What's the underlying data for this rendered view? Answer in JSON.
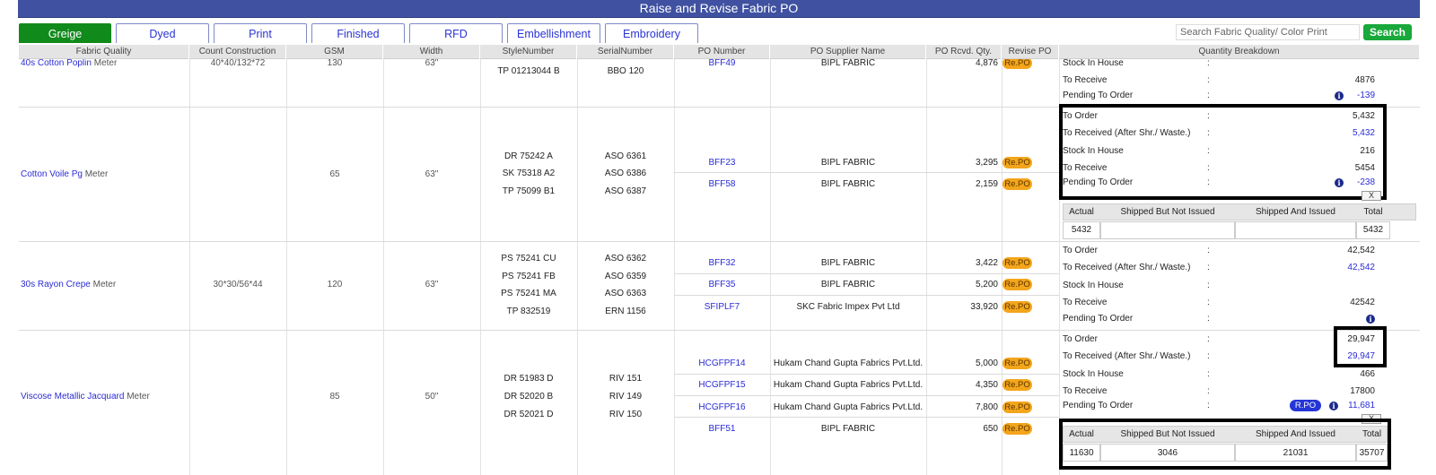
{
  "title": "Raise and Revise Fabric PO",
  "tabs": [
    {
      "label": "Greige",
      "active": true
    },
    {
      "label": "Dyed",
      "active": false
    },
    {
      "label": "Print",
      "active": false
    },
    {
      "label": "Finished",
      "active": false
    },
    {
      "label": "RFD",
      "active": false
    },
    {
      "label": "Embellishment",
      "active": false
    },
    {
      "label": "Embroidery",
      "active": false
    }
  ],
  "search": {
    "placeholder": "Search Fabric Quality/ Color Print",
    "button_label": "Search"
  },
  "columns": [
    "Fabric Quality",
    "Count Construction",
    "GSM",
    "Width",
    "StyleNumber",
    "SerialNumber",
    "PO Number",
    "PO Supplier Name",
    "PO Rcvd. Qty.",
    "Revise PO",
    "Quantity Breakdown"
  ],
  "labels": {
    "to_order": "To Order",
    "to_received": "To Received (After Shr./ Waste.)",
    "stock_in_house": "Stock In House",
    "to_receive": "To Receive",
    "pending_to_order": "Pending To Order",
    "colon": ":",
    "revise_badge": "Re.PO",
    "rpo_badge": "R.PO",
    "close": "X",
    "info": "i"
  },
  "breakdown_headers": [
    "Actual",
    "Shipped But Not Issued",
    "Shipped And Issued",
    "Total"
  ],
  "rows": [
    {
      "fabric": "40s Cotton Poplin",
      "unit": "Meter",
      "count": "40*40/132*72",
      "gsm": "130",
      "width": "63\"",
      "styles": [
        "TP 01213044 B"
      ],
      "serials": [
        "BBO 120"
      ],
      "pos": [
        {
          "po": "BFF49",
          "supplier": "BIPL FABRIC",
          "qty": "4,876"
        }
      ],
      "qb": {
        "to_receive": "4876",
        "pending": "-139"
      }
    },
    {
      "fabric": "Cotton Voile Pg",
      "unit": "Meter",
      "count": "",
      "gsm": "65",
      "width": "63\"",
      "styles": [
        "DR 75242 A",
        "SK 75318 A2",
        "TP 75099 B1"
      ],
      "serials": [
        "ASO 6361",
        "ASO 6386",
        "ASO 6387"
      ],
      "pos": [
        {
          "po": "BFF23",
          "supplier": "BIPL FABRIC",
          "qty": "3,295"
        },
        {
          "po": "BFF58",
          "supplier": "BIPL FABRIC",
          "qty": "2,159"
        }
      ],
      "qb": {
        "to_order": "5,432",
        "to_received": "5,432",
        "stock": "216",
        "to_receive": "5454",
        "pending": "-238"
      },
      "breakdown": {
        "actual": "5432",
        "shipped_not_issued": "",
        "shipped_issued": "",
        "total": "5432"
      }
    },
    {
      "fabric": "30s Rayon Crepe",
      "unit": "Meter",
      "count": "30*30/56*44",
      "gsm": "120",
      "width": "63\"",
      "styles": [
        "PS 75241 CU",
        "PS 75241 FB",
        "PS 75241 MA",
        "TP 832519"
      ],
      "serials": [
        "ASO 6362",
        "ASO 6359",
        "ASO 6363",
        "ERN 1156"
      ],
      "pos": [
        {
          "po": "BFF32",
          "supplier": "BIPL FABRIC",
          "qty": "3,422"
        },
        {
          "po": "BFF35",
          "supplier": "BIPL FABRIC",
          "qty": "5,200"
        },
        {
          "po": "SFIPLF7",
          "supplier": "SKC Fabric Impex Pvt Ltd",
          "qty": "33,920"
        }
      ],
      "qb": {
        "to_order": "42,542",
        "to_received": "42,542",
        "stock": "",
        "to_receive": "42542",
        "pending": ""
      }
    },
    {
      "fabric": "Viscose Metallic Jacquard",
      "unit": "Meter",
      "count": "",
      "gsm": "85",
      "width": "50\"",
      "styles": [
        "DR 51983 D",
        "DR 52020 B",
        "DR 52021 D"
      ],
      "serials": [
        "RIV 151",
        "RIV 149",
        "RIV 150"
      ],
      "pos": [
        {
          "po": "HCGFPF14",
          "supplier": "Hukam Chand Gupta Fabrics Pvt.Ltd.",
          "qty": "5,000"
        },
        {
          "po": "HCGFPF15",
          "supplier": "Hukam Chand Gupta Fabrics Pvt.Ltd.",
          "qty": "4,350"
        },
        {
          "po": "HCGFPF16",
          "supplier": "Hukam Chand Gupta Fabrics Pvt.Ltd.",
          "qty": "7,800"
        },
        {
          "po": "BFF51",
          "supplier": "BIPL FABRIC",
          "qty": "650"
        }
      ],
      "qb": {
        "to_order": "29,947",
        "to_received": "29,947",
        "stock": "466",
        "to_receive": "17800",
        "pending": "11,681"
      },
      "breakdown": {
        "actual": "11630",
        "shipped_not_issued": "3046",
        "shipped_issued": "21031",
        "total": "35707"
      }
    }
  ],
  "colors": {
    "header": "#3f51a0",
    "active_tab": "#118a1c",
    "search_button": "#19a83a",
    "badge": "#f3a51b",
    "link": "#2a2bd6"
  }
}
